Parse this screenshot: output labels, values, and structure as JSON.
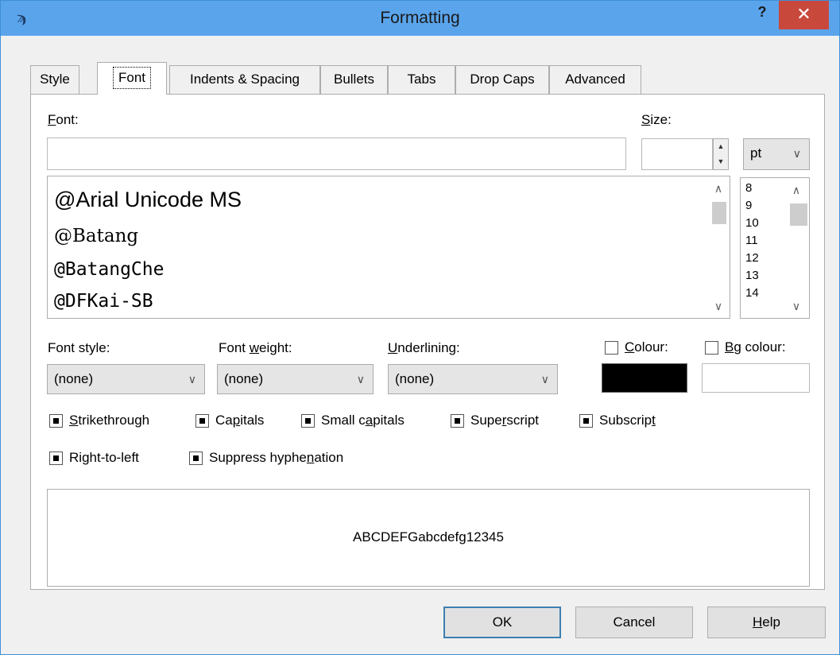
{
  "window": {
    "title": "Formatting",
    "help_label": "?",
    "close_label": "✕"
  },
  "tabs": [
    {
      "label": "Style",
      "active": false
    },
    {
      "label": "Font",
      "active": true
    },
    {
      "label": "Indents & Spacing",
      "active": false
    },
    {
      "label": "Bullets",
      "active": false
    },
    {
      "label": "Tabs",
      "active": false
    },
    {
      "label": "Drop Caps",
      "active": false
    },
    {
      "label": "Advanced",
      "active": false
    }
  ],
  "font_section": {
    "font_label_mnemonic": "F",
    "font_label_rest": "ont:",
    "font_value": "",
    "size_label_mnemonic": "S",
    "size_label_rest": "ize:",
    "size_value": "",
    "unit_value": "pt",
    "font_list": [
      "@Arial Unicode MS",
      "@Batang",
      "@BatangChe",
      "@DFKai-SB"
    ],
    "size_list": [
      "8",
      "9",
      "10",
      "11",
      "12",
      "13",
      "14"
    ]
  },
  "style_row": {
    "font_style_label": "Font style:",
    "font_style_value": "(none)",
    "font_weight_label_pre": "Font ",
    "font_weight_label_mn": "w",
    "font_weight_label_post": "eight:",
    "font_weight_value": "(none)",
    "underlining_label_mn": "U",
    "underlining_label_post": "nderlining:",
    "underlining_value": "(none)",
    "colour_label_mn": "C",
    "colour_label_post": "olour:",
    "colour_swatch": "#000000",
    "bg_colour_label_mn": "B",
    "bg_colour_label_post": "g colour:"
  },
  "effects": {
    "strikethrough": {
      "mn": "S",
      "post": "trikethrough"
    },
    "capitals": {
      "pre": "Ca",
      "mn": "p",
      "post": "itals"
    },
    "small_capitals": {
      "pre": "Small c",
      "mn": "a",
      "post": "pitals"
    },
    "superscript": {
      "pre": "Supe",
      "mn": "r",
      "post": "script"
    },
    "subscript": {
      "pre": "Subscrip",
      "mn": "t",
      "post": ""
    },
    "right_to_left": {
      "pre": "Ri",
      "mn": "g",
      "post": "ht-to-left"
    },
    "suppress_hyphenation": {
      "pre": "Suppress hyphe",
      "mn": "n",
      "post": "ation"
    }
  },
  "preview_text": "ABCDEFGabcdefg12345",
  "buttons": {
    "ok": "OK",
    "cancel": "Cancel",
    "help_mn": "H",
    "help_post": "elp"
  }
}
